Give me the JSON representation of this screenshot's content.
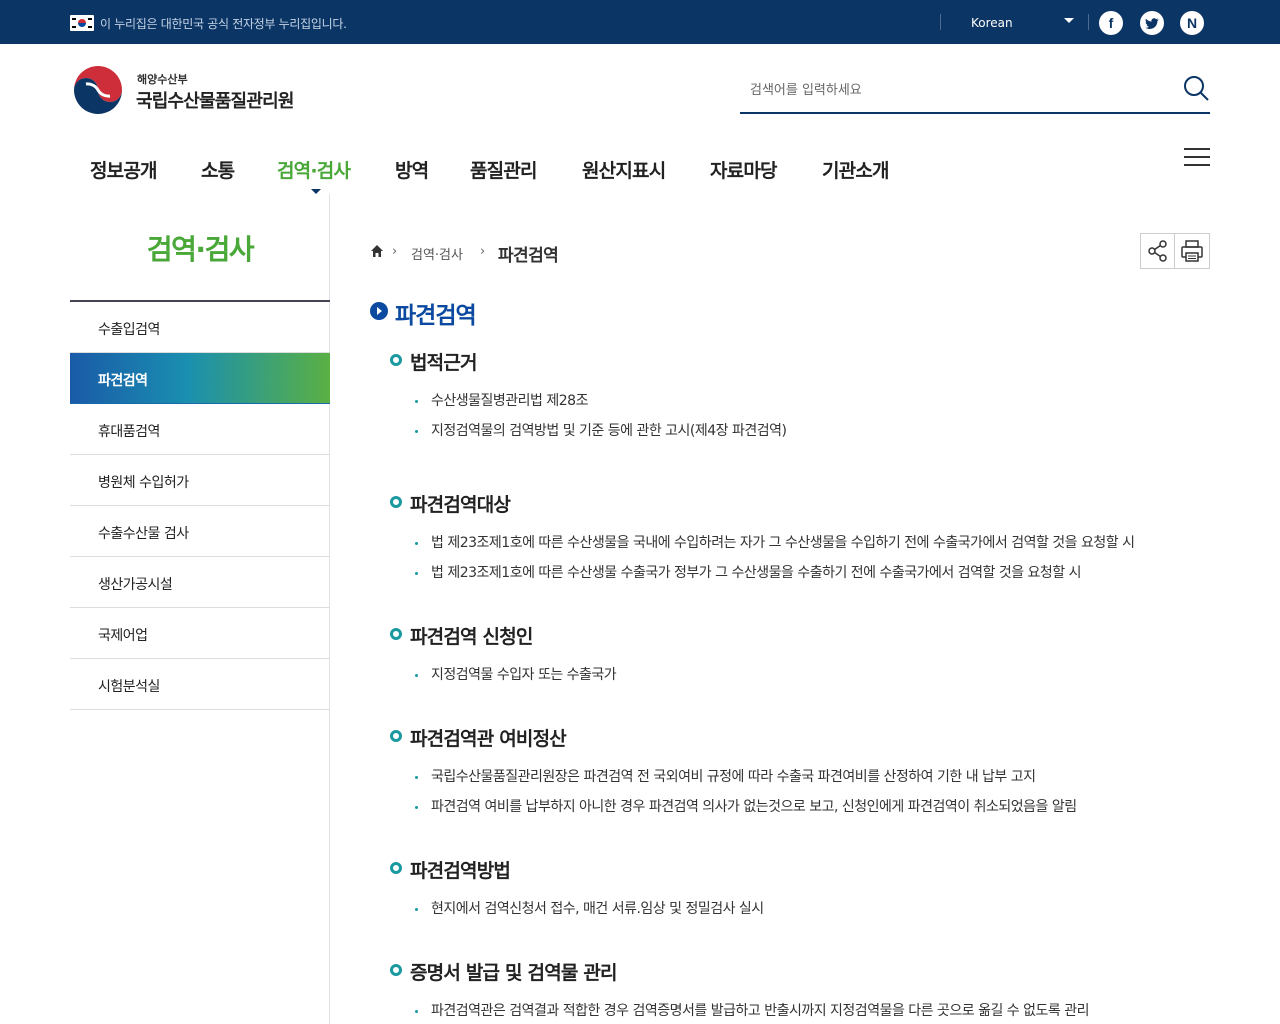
{
  "topbar": {
    "gov_notice": "이 누리집은 대한민국 공식 전자정부 누리집입니다.",
    "language": "Korean",
    "sns": [
      "facebook-icon",
      "twitter-icon",
      "naver-blog-icon"
    ]
  },
  "header": {
    "ministry": "해양수산부",
    "org_name": "국립수산물품질관리원",
    "search_placeholder": "검색어를 입력하세요"
  },
  "gnb": {
    "items": [
      "정보공개",
      "소통",
      "검역·검사",
      "방역",
      "품질관리",
      "원산지표시",
      "자료마당",
      "기관소개"
    ],
    "active": "검역·검사"
  },
  "lnb": {
    "title": "검역·검사",
    "items": [
      "수출입검역",
      "파견검역",
      "휴대품검역",
      "병원체 수입허가",
      "수출수산물 검사",
      "생산가공시설",
      "국제어업",
      "시험분석실"
    ],
    "active": "파견검역"
  },
  "breadcrumb": {
    "level1": "검역·검사",
    "current": "파견검역"
  },
  "content": {
    "title": "파견검역",
    "sections": [
      {
        "heading": "법적근거",
        "items": [
          "수산생물질병관리법 제28조",
          "지정검역물의 검역방법 및 기준 등에 관한 고시(제4장 파견검역)"
        ]
      },
      {
        "heading": "파견검역대상",
        "items": [
          "법 제23조제1호에 따른 수산생물을 국내에 수입하려는 자가 그 수산생물을 수입하기 전에 수출국가에서 검역할 것을 요청할 시",
          "법 제23조제1호에 따른 수산생물 수출국가 정부가 그 수산생물을 수출하기 전에 수출국가에서 검역할 것을 요청할 시"
        ]
      },
      {
        "heading": "파견검역 신청인",
        "items": [
          "지정검역물 수입자 또는 수출국가"
        ]
      },
      {
        "heading": "파견검역관 여비정산",
        "items": [
          "국립수산물품질관리원장은 파견검역 전 국외여비 규정에 따라 수출국 파견여비를 산정하여 기한 내 납부 고지",
          "파견검역 여비를 납부하지 아니한 경우 파견검역 의사가 없는것으로 보고, 신청인에게 파견검역이 취소되었음을 알림"
        ]
      },
      {
        "heading": "파견검역방법",
        "items": [
          "현지에서 검역신청서 접수, 매건 서류.임상 및 정밀검사 실시"
        ]
      },
      {
        "heading": "증명서 발급 및 검역물 관리",
        "items": [
          "파견검역관은 검역결과 적합한 경우 검역증명서를 발급하고 반출시까지 지정검역물을 다른 곳으로 옮길 수 없도록 관리"
        ]
      }
    ]
  },
  "colors": {
    "navy": "#0b3565",
    "green": "#4aa839",
    "title_blue": "#0b4aa0",
    "teal": "#1a9aa0"
  }
}
